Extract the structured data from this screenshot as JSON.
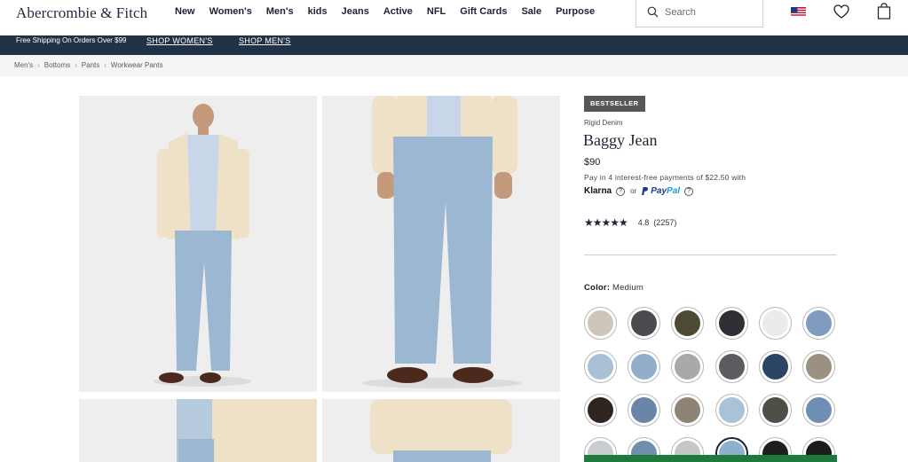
{
  "header": {
    "logo": "Abercrombie & Fitch",
    "nav": [
      "New",
      "Women's",
      "Men's",
      "kids",
      "Jeans",
      "Active",
      "NFL",
      "Gift Cards",
      "Sale",
      "Purpose"
    ],
    "search_placeholder": "Search"
  },
  "promo": {
    "shipping": "Free Shipping On Orders Over $99",
    "shop_women": "SHOP WOMEN'S",
    "shop_men": "SHOP MEN'S"
  },
  "breadcrumb": [
    "Men's",
    "Bottoms",
    "Pants",
    "Workwear Pants"
  ],
  "product": {
    "badge": "BESTSELLER",
    "subtitle": "Rigid Denim",
    "title": "Baggy Jean",
    "price": "$90",
    "installments": "Pay in 4 interest-free payments of $22.50 with",
    "klarna": "Klarna",
    "or": "or",
    "paypal_pay": "Pay",
    "paypal_pal": "Pal",
    "stars": "★★★★★",
    "rating": "4.8",
    "reviews": "(2257)",
    "color_label": "Color:",
    "color_value": "Medium"
  },
  "swatch_colors": [
    "#cfc6bb",
    "#4a4b4e",
    "#4c4a32",
    "#2e3036",
    "#ecebea",
    "#7f9bbd",
    "#a9c1d6",
    "#93aecb",
    "#a9a9a9",
    "#5a5c5f",
    "#2c4567",
    "#9b9182",
    "#2e2420",
    "#6a85a8",
    "#8d8475",
    "#a9c2d6",
    "#4f4f47",
    "#6f8fb2",
    "#c9ccd0",
    "#6f8fad",
    "#c6c6c6",
    "#8db0cf",
    "#1f1f1f",
    "#1c1c1c"
  ],
  "colors": {
    "promo_bg": "#223246",
    "cta_green": "#1d7a3a",
    "badge_bg": "#575757"
  }
}
